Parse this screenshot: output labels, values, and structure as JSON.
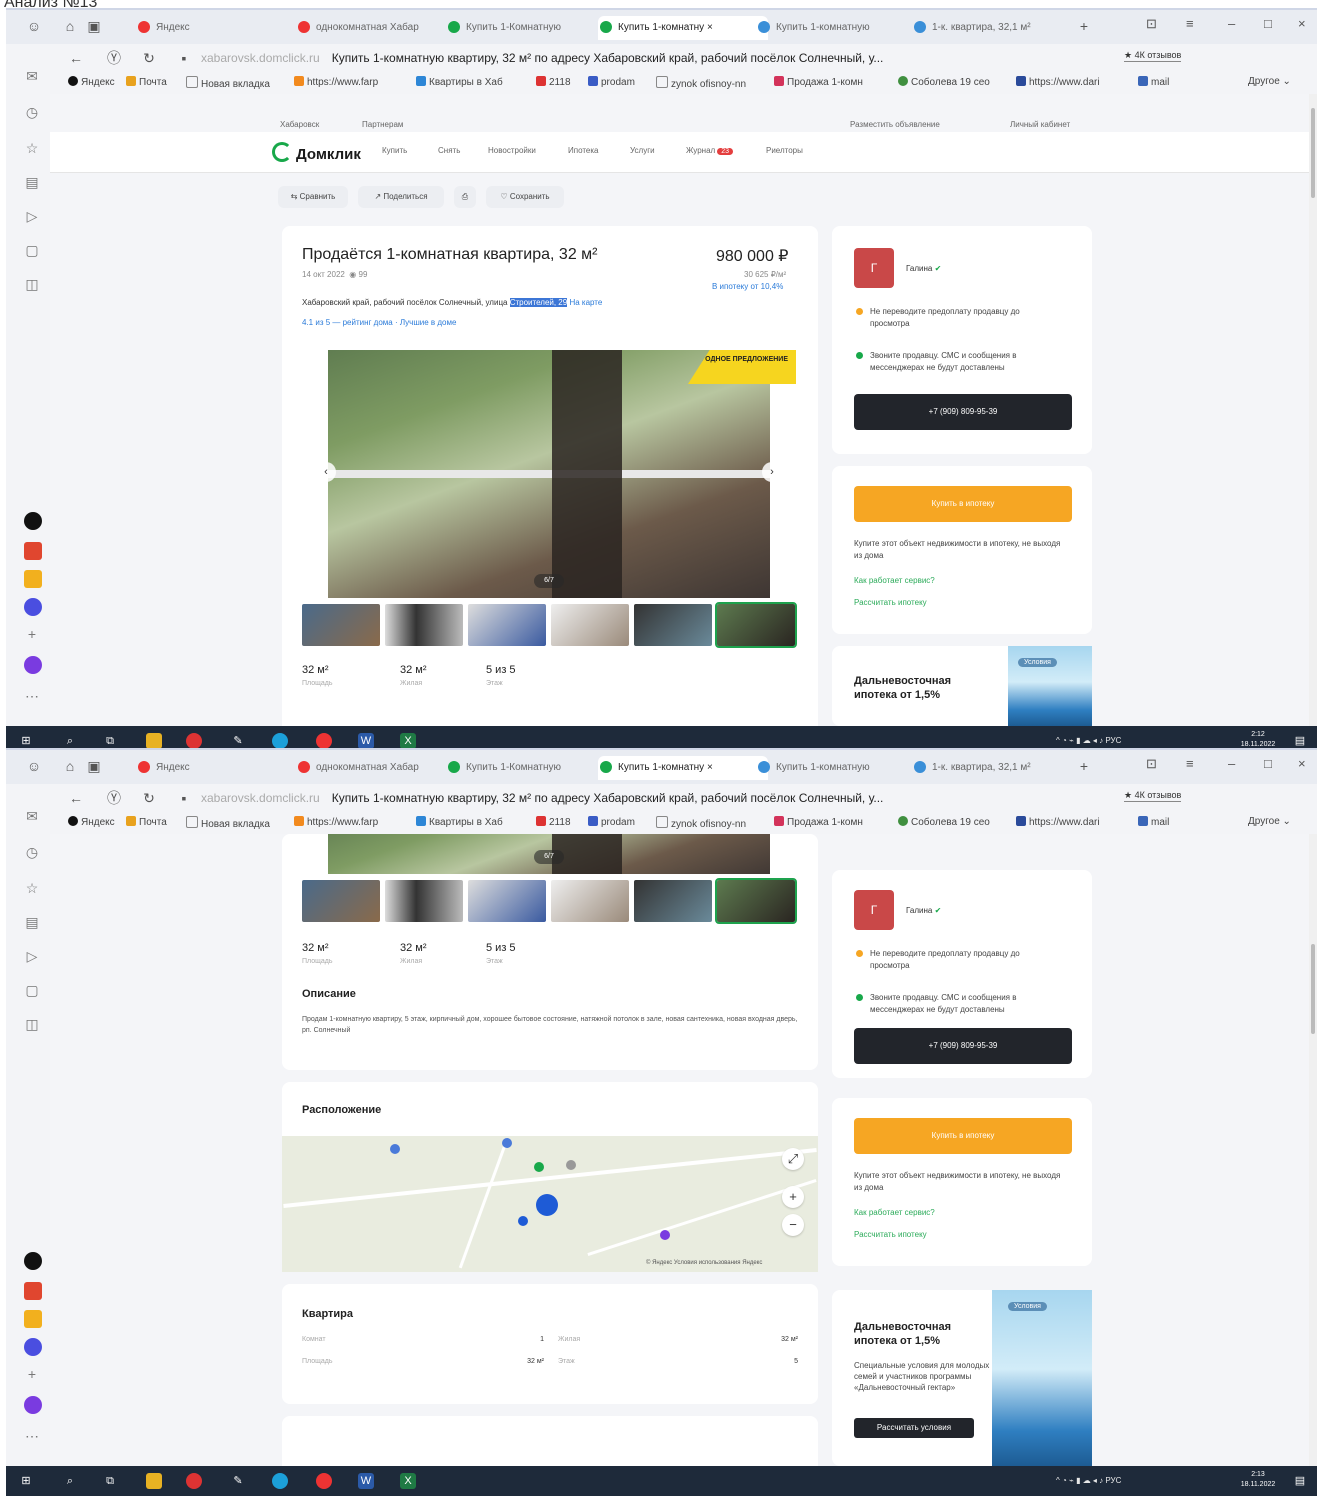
{
  "caption": "Анализ №13",
  "browser": {
    "tabs": [
      {
        "label": "Яндекс"
      },
      {
        "label": "однокомнатная Хабар"
      },
      {
        "label": "Купить 1-Комнатную"
      },
      {
        "label": "Купить 1-комнатну"
      },
      {
        "label": "Купить 1-комнатную"
      },
      {
        "label": "1-к. квартира, 32,1 м²"
      }
    ],
    "host": "xabarovsk.domclick.ru",
    "page_title": "Купить 1-комнатную квартиру, 32 м² по адресу Хабаровский край, рабочий посёлок Солнечный, у...",
    "reviews_chip": "★ 4К отзывов",
    "bookmarks": [
      "Яндекс",
      "Почта",
      "Новая вкладка",
      "https://www.farp",
      "Квартиры в Хаб",
      "2118",
      "prodam",
      "zynok ofisnoy-nn",
      "Продажа 1-комн",
      "Соболева 19 сео",
      "https://www.dari",
      "mail",
      "Другое"
    ]
  },
  "site": {
    "logo": "Домклик",
    "nav": [
      "Купить",
      "Снять",
      "Новостройки",
      "Ипотека",
      "Услуги",
      "Журнал",
      "Риелторы"
    ],
    "nav_badge": "23",
    "sub_left": [
      "Хабаровск",
      "Партнерам"
    ],
    "sub_right": [
      "Разместить объявление",
      "Личный кабинет"
    ],
    "actions": [
      "Сравнить",
      "Поделиться",
      "Сохранить"
    ]
  },
  "listing": {
    "title": "Продаётся 1-комнатная квартира, 32 м²",
    "date": "14 окт 2022",
    "views": "99",
    "price": "980 000 ₽",
    "price_per_m": "30 625 ₽/м²",
    "mortgage_hint": "В ипотеку от 10,4%",
    "address_prefix": "Хабаровский край, рабочий посёлок Солнечный, улица",
    "address_selected": "Строителей, 29",
    "map_link": "На карте",
    "rating_line": "4.1 из 5 — рейтинг дома · Лучшие в доме",
    "promo": "ВЫГОДНОЕ ПРЕДЛОЖЕНИЕ",
    "photo_counter": "6/7",
    "stats": [
      {
        "value": "32 м²",
        "label": "Площадь"
      },
      {
        "value": "32 м²",
        "label": "Жилая"
      },
      {
        "value": "5 из 5",
        "label": "Этаж"
      }
    ],
    "description_title": "Описание",
    "description": "Продам 1-комнатную квартиру, 5 этаж, кирпичный дом, хорошее бытовое состояние, натяжной потолок в зале, новая сантехника, новая входная дверь, рп. Солнечный",
    "location_title": "Расположение",
    "map_copy": "© Яндекс Условия использования Яндекс",
    "flat_title": "Квартира",
    "flat_rows": [
      {
        "k1": "Комнат",
        "v1": "1",
        "k2": "Жилая",
        "v2": "32 м²"
      },
      {
        "k1": "Площадь",
        "v1": "32 м²",
        "k2": "Этаж",
        "v2": "5"
      }
    ]
  },
  "seller": {
    "avatar": "Г",
    "name": "Галина",
    "note1": "Не переводите предоплату продавцу до просмотра",
    "note2": "Звоните продавцу. СМС и сообщения в мессенджерах не будут доставлены",
    "phone": "+7 (909) 809-95-39"
  },
  "mortgage": {
    "button": "Купить в ипотеку",
    "text": "Купите этот объект недвижимости в ипотеку, не выходя из дома",
    "link1": "Как работает сервис?",
    "link2": "Рассчитать ипотеку"
  },
  "banner": {
    "title": "Дальневосточная ипотека от 1,5%",
    "chip": "Условия",
    "text": "Специальные условия для молодых семей и участников программы «Дальневосточный гектар»",
    "button": "Рассчитать условия"
  },
  "taskbar": {
    "lang": "РУС",
    "clock1_time": "2:12",
    "clock1_date": "18.11.2022",
    "clock2_time": "2:13",
    "clock2_date": "18.11.2022"
  },
  "colors": {
    "accent": "#18a84a",
    "orange": "#f6a623",
    "dark": "#22252b",
    "promo": "#f6d51f"
  }
}
